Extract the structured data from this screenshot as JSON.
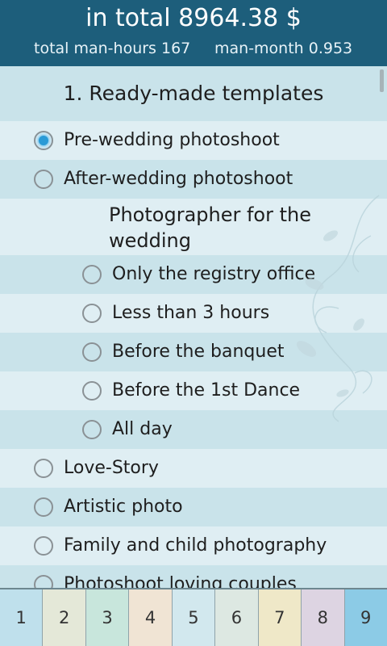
{
  "header": {
    "total": "in total 8964.38 $",
    "man_hours": "total man-hours 167",
    "man_month": "man-month 0.953"
  },
  "section": {
    "title": "1. Ready-made templates"
  },
  "options": {
    "pre_wedding": "Pre-wedding photoshoot",
    "after_wedding": "After-wedding photoshoot",
    "photographer_heading": "Photographer for the wedding",
    "registry": "Only the registry office",
    "less_3h": "Less than 3 hours",
    "banquet": "Before the banquet",
    "first_dance": "Before the 1st Dance",
    "all_day": "All day",
    "love_story": "Love-Story",
    "artistic": "Artistic photo",
    "family": "Family and child photography",
    "couples": "Photoshoot loving couples"
  },
  "selected": "Pre-wedding photoshoot",
  "tabs": [
    {
      "label": "1",
      "color": "#bfe0ec"
    },
    {
      "label": "2",
      "color": "#e4e8d8"
    },
    {
      "label": "3",
      "color": "#c8e6dc"
    },
    {
      "label": "4",
      "color": "#f0e4d4"
    },
    {
      "label": "5",
      "color": "#d2e8ee"
    },
    {
      "label": "6",
      "color": "#dde8e2"
    },
    {
      "label": "7",
      "color": "#efe8c8"
    },
    {
      "label": "8",
      "color": "#ddd4e2"
    },
    {
      "label": "9",
      "color": "#8ccbe6"
    }
  ]
}
